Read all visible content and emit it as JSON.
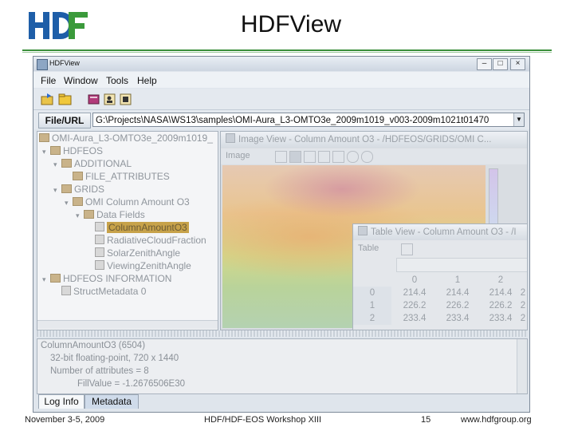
{
  "slide": {
    "title": "HDFView",
    "logo_text": "HDF",
    "footer": {
      "date": "November 3-5, 2009",
      "event": "HDF/HDF-EOS Workshop XIII",
      "page": "15",
      "url": "www.hdfgroup.org"
    },
    "accent_color": "#3b8f3b"
  },
  "window": {
    "title": "HDFView",
    "menu": [
      "File",
      "Window",
      "Tools",
      "Help"
    ],
    "controls": [
      "minimize-icon",
      "maximize-icon",
      "close-icon"
    ],
    "file_url_label": "File/URL",
    "file_url_value": "G:\\Projects\\NASA\\WS13\\samples\\OMI-Aura_L3-OMTO3e_2009m1019_v003-2009m1021t01470",
    "toolbar_icons": [
      "open-file-icon",
      "open-folder-icon",
      "book-icon",
      "users-icon",
      "help-icon"
    ]
  },
  "tree": {
    "items": [
      {
        "label": "OMI-Aura_L3-OMTO3e_2009m1019_",
        "expander": "",
        "icon": "file-icon"
      },
      {
        "label": "HDFEOS",
        "expander": "▾",
        "icon": "folder-icon"
      },
      {
        "label": "ADDITIONAL",
        "expander": "▾",
        "icon": "folder-icon"
      },
      {
        "label": "FILE_ATTRIBUTES",
        "expander": "",
        "icon": "folder-icon"
      },
      {
        "label": "GRIDS",
        "expander": "▾",
        "icon": "folder-icon"
      },
      {
        "label": "OMI Column Amount O3",
        "expander": "▾",
        "icon": "folder-icon"
      },
      {
        "label": "Data Fields",
        "expander": "▾",
        "icon": "folder-icon"
      },
      {
        "label": "ColumnAmountO3",
        "expander": "",
        "icon": "dataset-icon",
        "selected": true
      },
      {
        "label": "RadiativeCloudFraction",
        "expander": "",
        "icon": "dataset-icon"
      },
      {
        "label": "SolarZenithAngle",
        "expander": "",
        "icon": "dataset-icon"
      },
      {
        "label": "ViewingZenithAngle",
        "expander": "",
        "icon": "dataset-icon"
      },
      {
        "label": "HDFEOS INFORMATION",
        "expander": "▾",
        "icon": "folder-icon"
      },
      {
        "label": "StructMetadata 0",
        "expander": "",
        "icon": "dataset-icon"
      }
    ]
  },
  "image_view": {
    "title": "Image View  -  Column Amount O3  -  /HDFEOS/GRIDS/OMI C...",
    "menu_label": "Image",
    "scale_labels": [
      "",
      "",
      "",
      "",
      "",
      "",
      ""
    ]
  },
  "table_view": {
    "title": "Table View  -  Column Amount O3  -  /I",
    "menu_label": "Table",
    "columns": [
      "0",
      "1",
      "2",
      ""
    ],
    "rows": [
      {
        "index": "0",
        "values": [
          "214.4",
          "214.4",
          "214.4",
          "2"
        ]
      },
      {
        "index": "1",
        "values": [
          "226.2",
          "226.2",
          "226.2",
          "2"
        ]
      },
      {
        "index": "2",
        "values": [
          "233.4",
          "233.4",
          "233.4",
          "2"
        ]
      }
    ]
  },
  "log": {
    "lines": [
      "ColumnAmountO3 (6504)",
      "32-bit floating-point,    720 x 1440",
      "Number of attributes = 8",
      "FillValue = -1.2676506E30"
    ]
  },
  "tabs": [
    {
      "label": "Log Info",
      "active": true
    },
    {
      "label": "Metadata",
      "active": false
    }
  ]
}
